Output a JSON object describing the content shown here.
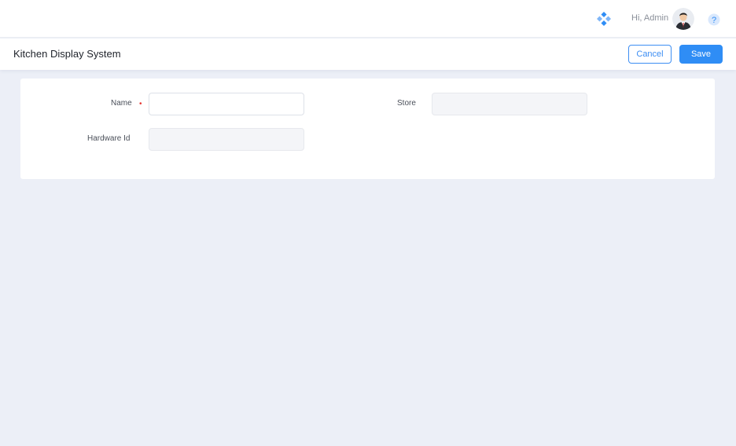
{
  "header": {
    "greeting": "Hi, Admin",
    "icons": {
      "apps": "apps-diamond-icon",
      "avatar": "admin-avatar",
      "help": "help-question-icon"
    }
  },
  "page": {
    "title": "Kitchen Display System",
    "cancel_label": "Cancel",
    "save_label": "Save"
  },
  "form": {
    "name": {
      "label": "Name",
      "value": "",
      "required": true
    },
    "store": {
      "label": "Store",
      "value": ""
    },
    "hardware_id": {
      "label": "Hardware Id",
      "value": ""
    }
  },
  "colors": {
    "accent": "#2f8df5",
    "background": "#eceff7",
    "required": "#e53935"
  }
}
